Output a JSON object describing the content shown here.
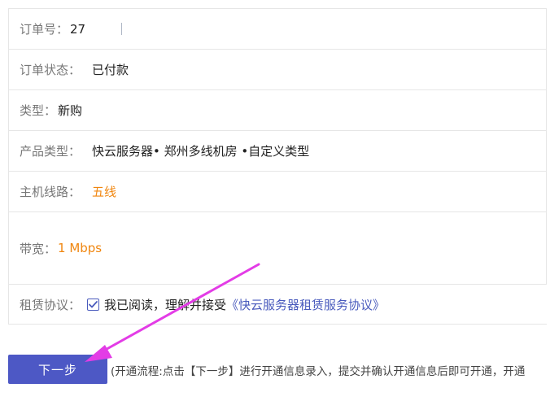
{
  "order_info": {
    "order_no": {
      "label": "订单号：",
      "value": "27"
    },
    "order_status": {
      "label": "订单状态：",
      "value": "已付款"
    },
    "type": {
      "label": "类型：",
      "value": "新购"
    },
    "product_type": {
      "label": "产品类型：",
      "value": "快云服务器• 郑州多线机房 •自定义类型"
    },
    "host_line": {
      "label": "主机线路：",
      "value": "五线"
    },
    "bandwidth": {
      "label": "带宽：",
      "value": "1 Mbps"
    },
    "agreement": {
      "label": "租赁协议：",
      "checked": true,
      "text": "我已阅读，理解并接受",
      "link_text": "《快云服务器租赁服务协议》"
    }
  },
  "actions": {
    "next_label": "下一步",
    "flow_hint": "(开通流程:点击【下一步】进行开通信息录入，提交并确认开通信息后即可开通，开通"
  },
  "colors": {
    "accent": "#4d58c5",
    "link": "#4a5bbd",
    "highlight_value": "#f0860f",
    "annotation_arrow": "#e33ce6"
  },
  "icons": {
    "checkbox": "check-icon",
    "annotation": "annotation-arrow-icon"
  }
}
